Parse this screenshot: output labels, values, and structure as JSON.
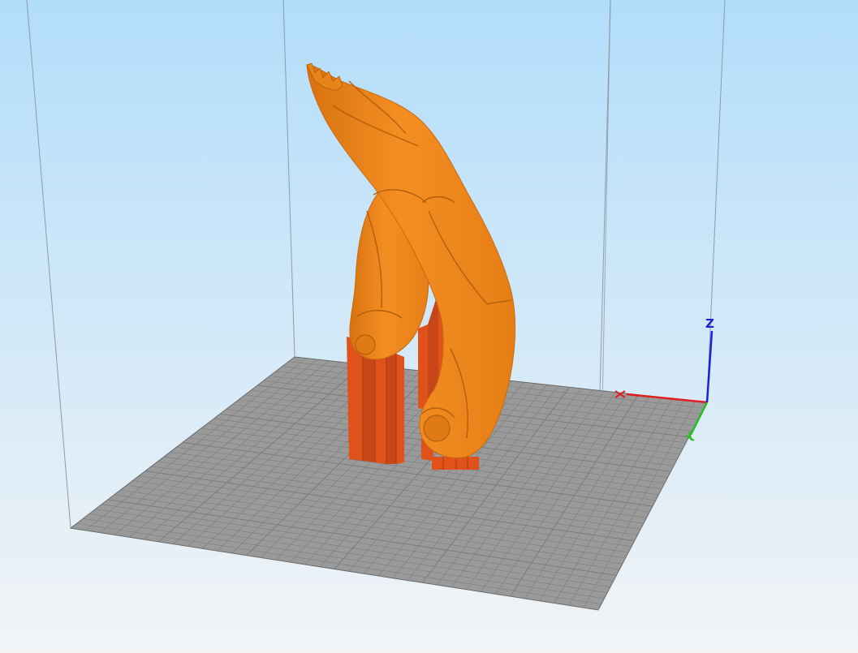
{
  "viewport": {
    "background_top": "#b2ddfb",
    "background_bottom": "#f2f4f6"
  },
  "build_plate": {
    "color": "#9a9a9a",
    "grid_color": "#7c7c7c",
    "edge_color": "#6a6a6a"
  },
  "build_volume": {
    "line_color": "#8f9aa4"
  },
  "model": {
    "color": "#f08a1c",
    "shade_color": "#c86a10",
    "highlight_color": "#ff9f3a"
  },
  "supports": {
    "color": "#e0521a",
    "shade_color": "#b23c10"
  },
  "axis_gizmo": {
    "x_color": "#e02020",
    "y_color": "#20c020",
    "z_color": "#1a22d8",
    "z_label": "Z"
  }
}
